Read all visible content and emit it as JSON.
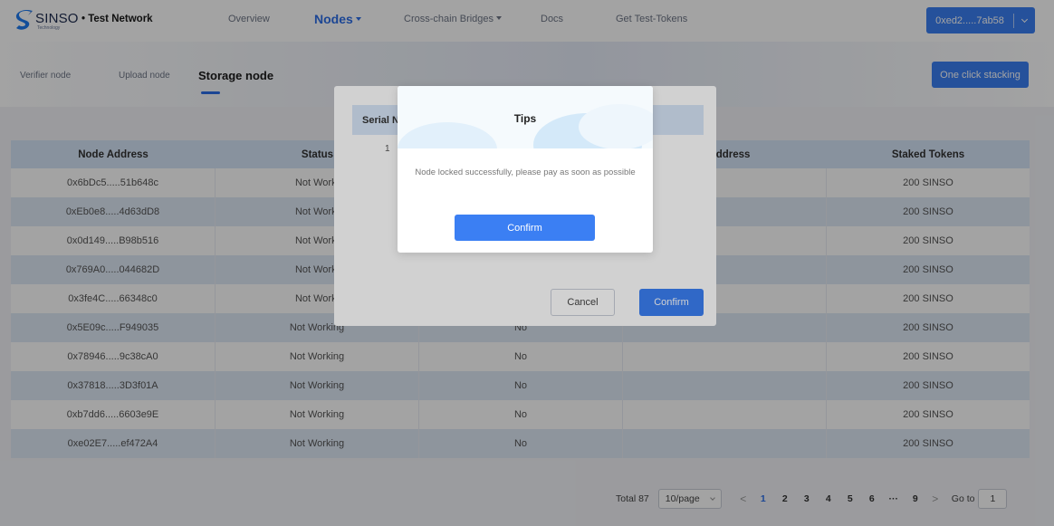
{
  "navbar": {
    "logo_text": "SINSO",
    "logo_sub": "Technology",
    "network": "• Test Network",
    "items": [
      {
        "label": "Overview"
      },
      {
        "label": "Nodes"
      },
      {
        "label": "Cross-chain Bridges"
      },
      {
        "label": "Docs"
      },
      {
        "label": "Get Test-Tokens"
      }
    ],
    "wallet": "0xed2.....7ab58"
  },
  "subnav": {
    "tabs": [
      {
        "label": "Verifier node"
      },
      {
        "label": "Upload node"
      },
      {
        "label": "Storage node"
      }
    ],
    "action_label": "One click stacking"
  },
  "table": {
    "headers": [
      "Node Address",
      "Status",
      "",
      "g Address",
      "Staked Tokens"
    ],
    "rows": [
      {
        "address": "0x6bDc5.....51b648c",
        "status": "Not Worki",
        "c3": "",
        "c4": "",
        "tokens": "200 SINSO"
      },
      {
        "address": "0xEb0e8.....4d63dD8",
        "status": "Not Worki",
        "c3": "",
        "c4": "",
        "tokens": "200 SINSO"
      },
      {
        "address": "0x0d149.....B98b516",
        "status": "Not Worki",
        "c3": "",
        "c4": "",
        "tokens": "200 SINSO"
      },
      {
        "address": "0x769A0.....044682D",
        "status": "Not Worki",
        "c3": "",
        "c4": "",
        "tokens": "200 SINSO"
      },
      {
        "address": "0x3fe4C.....66348c0",
        "status": "Not Worki",
        "c3": "",
        "c4": "",
        "tokens": "200 SINSO"
      },
      {
        "address": "0x5E09c.....F949035",
        "status": "Not Working",
        "c3": "No",
        "c4": "",
        "tokens": "200 SINSO"
      },
      {
        "address": "0x78946.....9c38cA0",
        "status": "Not Working",
        "c3": "No",
        "c4": "",
        "tokens": "200 SINSO"
      },
      {
        "address": "0x37818.....3D3f01A",
        "status": "Not Working",
        "c3": "No",
        "c4": "",
        "tokens": "200 SINSO"
      },
      {
        "address": "0xb7dd6.....6603e9E",
        "status": "Not Working",
        "c3": "No",
        "c4": "",
        "tokens": "200 SINSO"
      },
      {
        "address": "0xe02E7.....ef472A4",
        "status": "Not Working",
        "c3": "No",
        "c4": "",
        "tokens": "200 SINSO"
      }
    ]
  },
  "pagination": {
    "total": "Total 87",
    "page_size": "10/page",
    "prev": "<",
    "next": ">",
    "pages": [
      "1",
      "2",
      "3",
      "4",
      "5",
      "6",
      "···",
      "9"
    ],
    "active_page": "1",
    "goto_label": "Go to",
    "goto_value": "1"
  },
  "node_dialog": {
    "header": "Serial N",
    "row_value": "1",
    "cancel_label": "Cancel",
    "confirm_label": "Confirm"
  },
  "tips_dialog": {
    "title": "Tips",
    "message": "Node locked successfully, please pay as soon as possible",
    "confirm_label": "Confirm"
  }
}
